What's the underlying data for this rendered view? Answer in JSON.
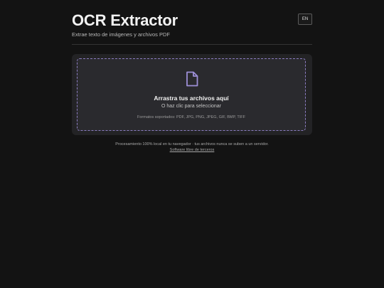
{
  "header": {
    "title": "OCR Extractor",
    "subtitle": "Extrae texto de imágenes y archivos PDF",
    "lang_button": "EN"
  },
  "upload": {
    "icon": "file-icon",
    "title": "Arrastra tus archivos aquí",
    "subtitle": "O haz clic para seleccionar",
    "formats": "Formatos soportados: PDF, JPG, PNG, JPEG, GIF, BMP, TIFF"
  },
  "footer": {
    "note": "Procesamiento 100% local en tu navegador · tus archivos nunca se suben a un servidor.",
    "link": "Software libre de terceros"
  },
  "colors": {
    "background": "#131313",
    "card": "#232325",
    "accent": "#8c7dc2"
  }
}
